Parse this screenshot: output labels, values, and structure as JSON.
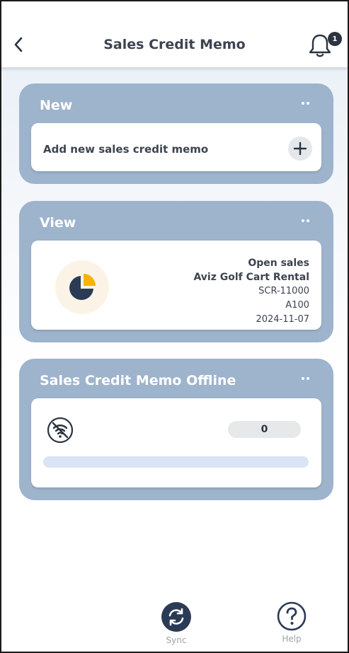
{
  "header": {
    "title": "Sales Credit Memo",
    "notification_count": "1",
    "back_icon": "chevron-left-icon",
    "bell_icon": "bell-icon"
  },
  "sections": {
    "new": {
      "title": "New",
      "add_label": "Add new sales credit memo",
      "add_icon": "plus-icon"
    },
    "view": {
      "title": "View",
      "status": "Open sales",
      "customer": "Aviz Golf Cart Rental",
      "document_no": "SCR-11000",
      "code": "A100",
      "date": "2024-11-07",
      "icon": "pie-chart-icon"
    },
    "offline": {
      "title": "Sales Credit Memo Offline",
      "count": "0",
      "progress": 0,
      "icon": "wifi-off-icon"
    }
  },
  "bottom_nav": {
    "sync_label": "Sync",
    "help_label": "Help"
  },
  "colors": {
    "section_bg": "#9eb3cc",
    "text_dark": "#3d4450",
    "accent_yellow": "#f5b400",
    "icon_dark": "#2b3a55"
  }
}
